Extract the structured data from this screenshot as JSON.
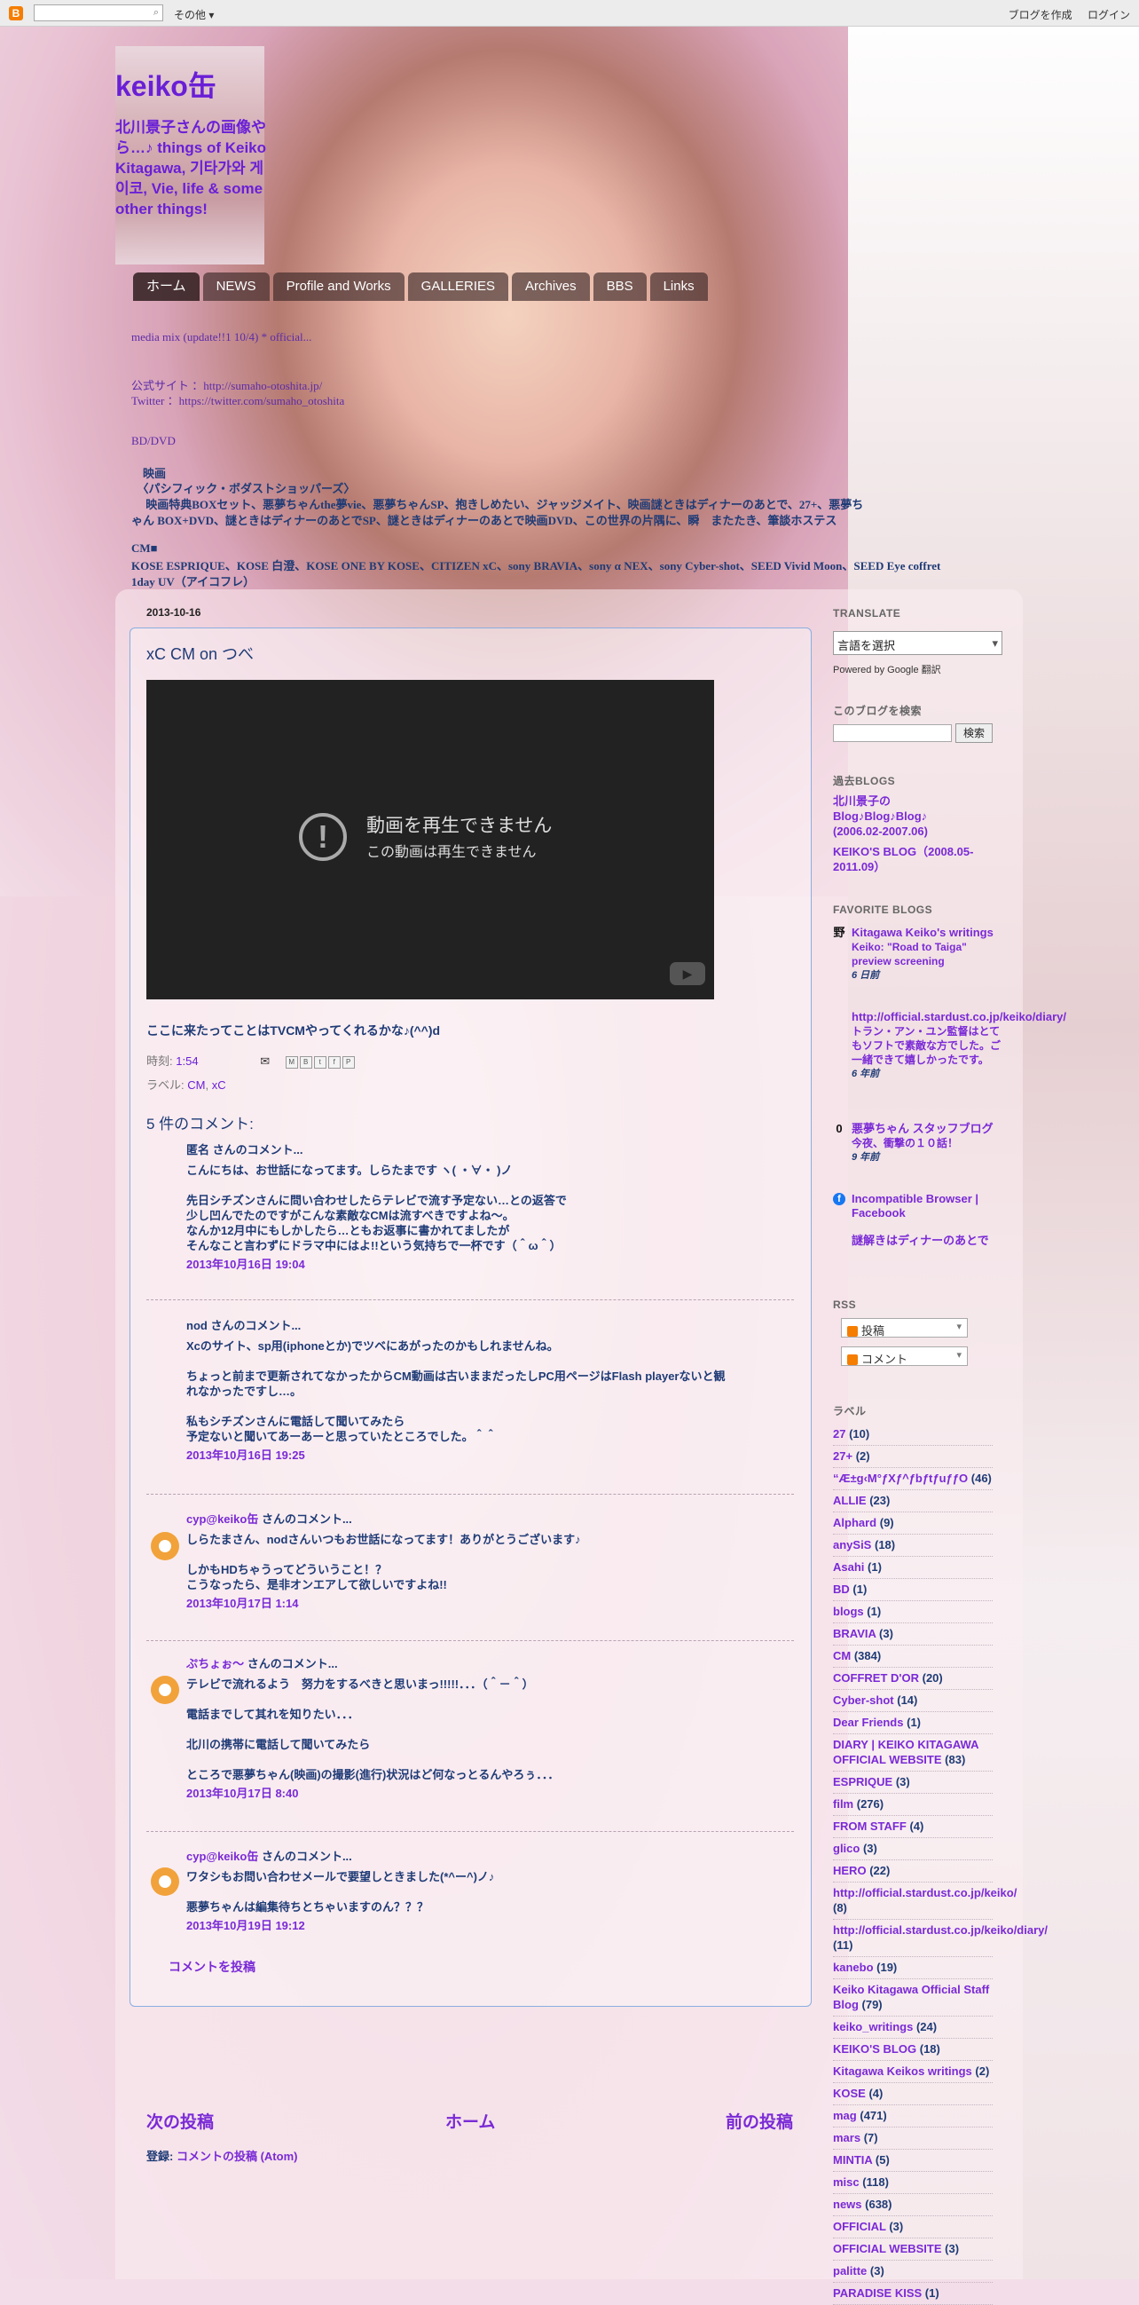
{
  "navbar": {
    "logo": "B",
    "search_placeholder": "",
    "more": "その他 ▾",
    "create_blog": "ブログを作成",
    "login": "ログイン"
  },
  "header": {
    "title": "keiko缶",
    "description": "北川景子さんの画像やら…♪     things of Keiko Kitagawa, 기타가와 게이코, Vie, life & some other things!"
  },
  "tabs": [
    "ホーム",
    "NEWS",
    "Profile and Works",
    "GALLERIES",
    "Archives",
    "BBS",
    "Links"
  ],
  "header_lines": [
    "media mix (update!!1 10/4)        * official...",
    "公式サイト ：http://sumaho-otoshita.jp/",
    "Twitter ：https://twitter.com/sumaho_otoshita",
    "BD/DVD",
    "　映画",
    "　〈パシフィック・ボダストショッパーズ〉",
    "　 映画特典BOXセット、悪夢ちゃんthe夢vie、悪夢ちゃんSP、抱きしめたい、ジャッジメイト、映画謎ときはディナーのあとで、27+、悪夢ち",
    "ゃん BOX+DVD、謎ときはディナーのあとでSP、謎ときはディナーのあとで映画DVD、この世界の片隅に、瞬　またたき、筆談ホステス",
    "CM■",
    "KOSE ESPRIQUE、KOSE 白澄、KOSE ONE BY KOSE、CITIZEN xC、sony BRAVIA、sony α NEX、sony Cyber-shot、SEED Vivid Moon、SEED Eye coffret",
    "1day UV（アイコフレ）"
  ],
  "post": {
    "date": "2013-10-16",
    "title": "xC CM on つべ",
    "video_error_title": "動画を再生できません",
    "video_error_sub": "この動画は再生できません",
    "video_error_icon": "!",
    "youtube_icon": "▶",
    "body": "ここに来たってことはTVCMやってくれるかな♪(^^)d",
    "time_label": "時刻:",
    "time": "1:54",
    "email_icon": "✉",
    "labels_label": "ラベル:",
    "label_cm": "CM",
    "label_xc": "xC",
    "share_icons": [
      "M",
      "B",
      "t",
      "f",
      "P"
    ]
  },
  "comments_header": "5 件のコメント:",
  "comments": [
    {
      "author": "匿名",
      "suffix": " さんのコメント...",
      "text": "こんにちは、お世話になってます。しらたまです ヽ( ・∀・ )ノ\n\n先日シチズンさんに問い合わせしたらテレビで流す予定ない…との返答で\n少し凹んでたのですがこんな素敵なCMは流すべきですよね～。\nなんか12月中にもしかしたら…ともお返事に書かれてましたが\nそんなこと言わずにドラマ中にはよ!!という気持ちで一杯です（＾ω＾）",
      "timestamp": "2013年10月16日 19:04"
    },
    {
      "author": "nod",
      "suffix": " さんのコメント...",
      "text": "Xcのサイト、sp用(iphoneとか)でツベにあがったのかもしれませんね。\n\nちょっと前まで更新されてなかったからCM動画は古いままだったしPC用ページはFlash playerないと観\nれなかったですし…。\n\n私もシチズンさんに電話して聞いてみたら\n予定ないと聞いてあーあーと思っていたところでした。＾＾",
      "timestamp": "2013年10月16日 19:25"
    },
    {
      "author": "cyp@keiko缶",
      "suffix": " さんのコメント...",
      "text": "しらたまさん、nodさんいつもお世話になってます！ありがとうございます♪\n\nしかもHDちゃうってどういうこと！？\nこうなったら、是非オンエアして欲しいですよね!!",
      "timestamp": "2013年10月17日 1:14"
    },
    {
      "author": "ぷちょぉ～",
      "suffix": " さんのコメント...",
      "text": "テレビで流れるよう　努力をするべきと思いまっ!!!!!．．．（＾－＾）\n\n電話までして其れを知りたい．．．\n\n北川の携帯に電話して聞いてみたら\n\nところで悪夢ちゃん(映画)の撮影(進行)状況はど何なっとるんやろぅ．．．",
      "timestamp": "2013年10月17日 8:40"
    },
    {
      "author": "cyp@keiko缶",
      "suffix": " さんのコメント...",
      "text": "ワタシもお問い合わせメールで要望しときました(*^ー^)ノ♪\n\n悪夢ちゃんは編集待ちとちゃいますのん？？？",
      "timestamp": "2013年10月19日 19:12"
    }
  ],
  "post_comment": "コメントを投稿",
  "pager": {
    "newer": "次の投稿",
    "home": "ホーム",
    "older": "前の投稿"
  },
  "subscribe": {
    "label": "登録:",
    "link": "コメントの投稿 (Atom)"
  },
  "sidebar": {
    "translate_heading": "TRANSLATE",
    "translate_select": "言語を選択",
    "powered_by": "Powered by Google 翻訳",
    "search_heading": "このブログを検索",
    "search_button": "検索",
    "past_blogs_heading": "過去BLOGS",
    "past_blogs": [
      "北川景子の Blog♪Blog♪Blog♪ (2006.02-2007.06)",
      "KEIKO'S BLOG（2008.05-2011.09）"
    ],
    "favorite_heading": "FAVORITE BLOGS",
    "favorites": [
      {
        "icon": "野",
        "title": "Kitagawa Keiko's writings",
        "snippet": "Keiko: \"Road to Taiga\" preview screening",
        "age": "6 日前"
      },
      {
        "icon": "",
        "title": "http://official.stardust.co.jp/keiko/diary/",
        "snippet": "トラン・アン・ユン監督はとてもソフトで素敵な方でした。ご一緒できて嬉しかったです。",
        "age": "6 年前"
      },
      {
        "icon": "0",
        "title": "悪夢ちゃん スタッフブログ",
        "snippet": "今夜、衝撃の１０話！",
        "age": "9 年前"
      },
      {
        "icon": "f",
        "title": "Incompatible Browser | Facebook",
        "snippet": "",
        "age": ""
      },
      {
        "icon": "",
        "title": "謎解きはディナーのあとで",
        "snippet": "",
        "age": ""
      }
    ],
    "rss_heading": "RSS",
    "rss_posts": "投稿",
    "rss_comments": "コメント",
    "labels_heading": "ラベル",
    "labels": [
      {
        "name": "27",
        "count": "(10)"
      },
      {
        "name": "27+",
        "count": "(2)"
      },
      {
        "name": "“Æ±g‹M°ƒXƒ^ƒbƒtƒuƒƒO",
        "count": "(46)"
      },
      {
        "name": "ALLIE",
        "count": "(23)"
      },
      {
        "name": "Alphard",
        "count": "(9)"
      },
      {
        "name": "anySiS",
        "count": "(18)"
      },
      {
        "name": "Asahi",
        "count": "(1)"
      },
      {
        "name": "BD",
        "count": "(1)"
      },
      {
        "name": "blogs",
        "count": "(1)"
      },
      {
        "name": "BRAVIA",
        "count": "(3)"
      },
      {
        "name": "CM",
        "count": "(384)"
      },
      {
        "name": "COFFRET D'OR",
        "count": "(20)"
      },
      {
        "name": "Cyber-shot",
        "count": "(14)"
      },
      {
        "name": "Dear Friends",
        "count": "(1)"
      },
      {
        "name": "DIARY | KEIKO KITAGAWA OFFICIAL WEBSITE",
        "count": "(83)"
      },
      {
        "name": "ESPRIQUE",
        "count": "(3)"
      },
      {
        "name": "film",
        "count": "(276)"
      },
      {
        "name": "FROM STAFF",
        "count": "(4)"
      },
      {
        "name": "glico",
        "count": "(3)"
      },
      {
        "name": "HERO",
        "count": "(22)"
      },
      {
        "name": "http://official.stardust.co.jp/keiko/",
        "count": "(8)"
      },
      {
        "name": "http://official.stardust.co.jp/keiko/diary/",
        "count": "(11)"
      },
      {
        "name": "kanebo",
        "count": "(19)"
      },
      {
        "name": "Keiko Kitagawa Official Staff Blog",
        "count": "(79)"
      },
      {
        "name": "keiko_writings",
        "count": "(24)"
      },
      {
        "name": "KEIKO'S BLOG",
        "count": "(18)"
      },
      {
        "name": "Kitagawa Keikos writings",
        "count": "(2)"
      },
      {
        "name": "KOSE",
        "count": "(4)"
      },
      {
        "name": "mag",
        "count": "(471)"
      },
      {
        "name": "mars",
        "count": "(7)"
      },
      {
        "name": "MINTIA",
        "count": "(5)"
      },
      {
        "name": "misc",
        "count": "(118)"
      },
      {
        "name": "news",
        "count": "(638)"
      },
      {
        "name": "OFFICIAL",
        "count": "(3)"
      },
      {
        "name": "OFFICIAL WEBSITE",
        "count": "(3)"
      },
      {
        "name": "palitte",
        "count": "(3)"
      },
      {
        "name": "PARADISE KISS",
        "count": "(1)"
      }
    ]
  }
}
